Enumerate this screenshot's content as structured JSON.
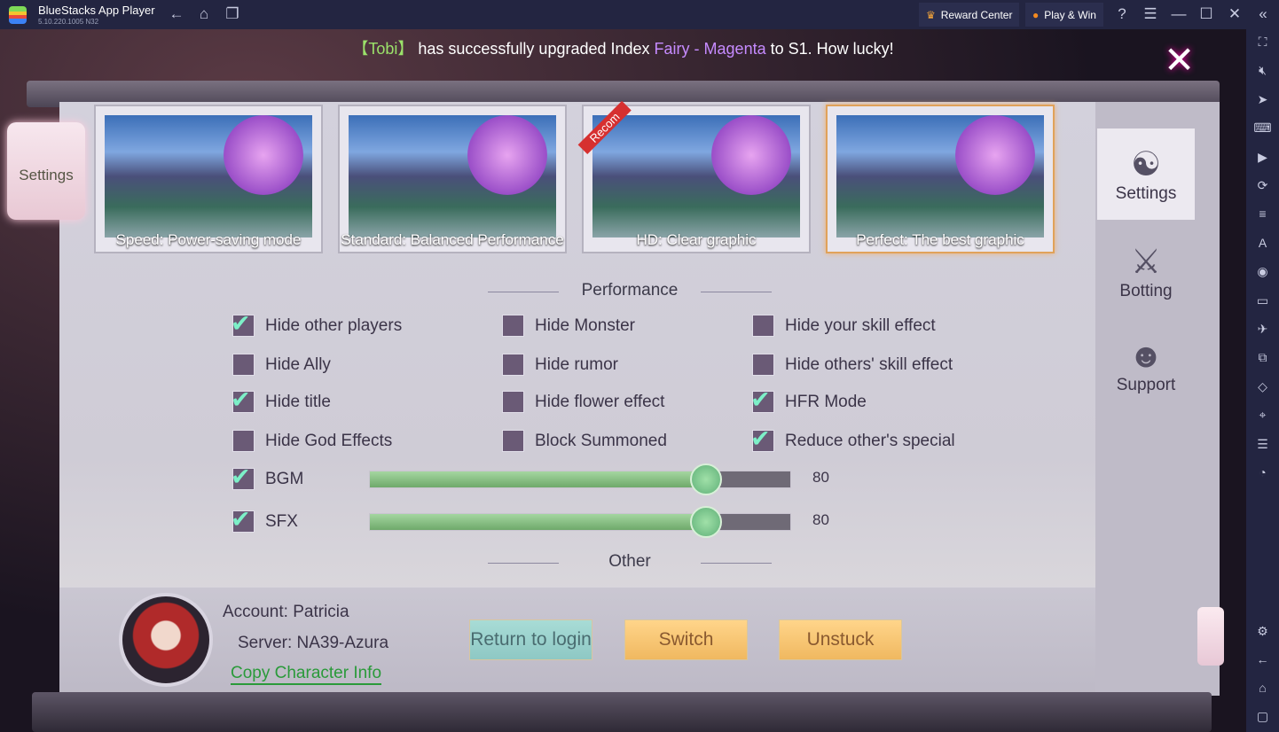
{
  "window": {
    "title": "BlueStacks App Player",
    "version": "5.10.220.1005  N32",
    "reward_center": "Reward Center",
    "play_win": "Play & Win"
  },
  "rightbar_icons": [
    "fullscreen-icon",
    "volume-mute-icon",
    "pointer-icon",
    "keyboard-icon",
    "macro-play-icon",
    "rotate-icon",
    "performance-icon",
    "install-apk-icon",
    "screenshot-icon",
    "folder-icon",
    "airplane-mode-icon",
    "multi-instance-icon",
    "eco-mode-icon",
    "location-icon",
    "layers-icon",
    "sync-icon"
  ],
  "rightbar_bottom_icons": [
    "settings-icon",
    "back-icon",
    "home-icon",
    "recents-icon"
  ],
  "banner": {
    "pre": "【Tobi】",
    "mid": " has successfully upgraded Index ",
    "item": "Fairy - Magenta",
    "post": " to S1. How lucky!"
  },
  "left_scroll": "Settings",
  "presets": [
    {
      "label": "Speed: Power-saving mode",
      "selected": false
    },
    {
      "label": "Standard: Balanced Performance",
      "selected": false
    },
    {
      "label": "HD: Clear graphic",
      "selected": false,
      "badge": "Recom"
    },
    {
      "label": "Perfect: The best graphic",
      "selected": true
    }
  ],
  "performance_title": "Performance",
  "options": [
    {
      "label": "Hide other players",
      "checked": true
    },
    {
      "label": "Hide Monster",
      "checked": false
    },
    {
      "label": "Hide your skill effect",
      "checked": false
    },
    {
      "label": "Hide Ally",
      "checked": false
    },
    {
      "label": "Hide rumor",
      "checked": false
    },
    {
      "label": "Hide others' skill effect",
      "checked": false
    },
    {
      "label": "Hide title",
      "checked": true
    },
    {
      "label": "Hide flower effect",
      "checked": false
    },
    {
      "label": "HFR Mode",
      "checked": true
    },
    {
      "label": "Hide God Effects",
      "checked": false
    },
    {
      "label": "Block Summoned",
      "checked": false
    },
    {
      "label": "Reduce other's special",
      "checked": true
    }
  ],
  "sliders": [
    {
      "label": "BGM",
      "checked": true,
      "value": 80,
      "max": 100
    },
    {
      "label": "SFX",
      "checked": true,
      "value": 80,
      "max": 100
    }
  ],
  "other_title": "Other",
  "account": {
    "account_label": "Account:",
    "account_value": "Patricia",
    "server_label": "Server:",
    "server_value": "NA39-Azura",
    "copy": "Copy Character Info"
  },
  "buttons": {
    "return": "Return to login",
    "switch": "Switch",
    "unstuck": "Unstuck"
  },
  "tabs": [
    {
      "label": "Settings",
      "active": true
    },
    {
      "label": "Botting"
    },
    {
      "label": "Support"
    }
  ]
}
